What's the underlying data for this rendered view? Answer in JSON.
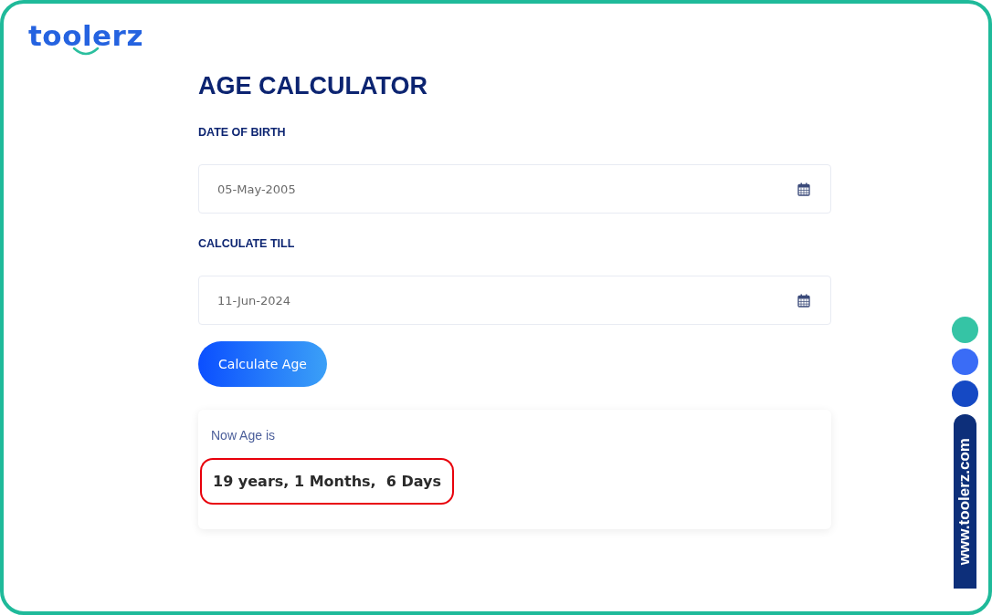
{
  "logo": {
    "text": "toolerz"
  },
  "title": "AGE CALCULATOR",
  "fields": [
    {
      "label": "DATE OF BIRTH",
      "value": "05-May-2005"
    },
    {
      "label": "CALCULATE TILL",
      "value": "11-Jun-2024"
    }
  ],
  "button": "Calculate Age",
  "result": {
    "label": "Now Age is",
    "value": "19 years, 1 Months,  6 Days",
    "highlighted": true
  },
  "side_dots": [
    {
      "color": "#35c4a5"
    },
    {
      "color": "#3a6cf6"
    },
    {
      "color": "#1549c4"
    }
  ],
  "side_badge": "www.toolerz.com"
}
